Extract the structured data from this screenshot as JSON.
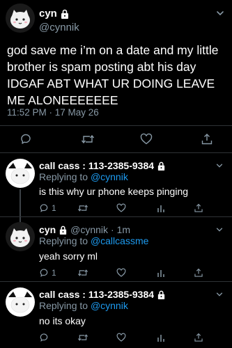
{
  "main_tweet": {
    "display_name": "cyn",
    "handle": "@cynnik",
    "text": "god save me i’m on a date and my little brother is spam posting abt his day IDGAF ABT WHAT UR DOING LEAVE ME ALONEEEEEEE",
    "timestamp": "11:52 PM · 17 May 26",
    "icons": [
      "lock-icon",
      "chevron-down-icon",
      "reply-icon",
      "retweet-icon",
      "like-icon",
      "share-icon"
    ]
  },
  "replies": [
    {
      "display_name": "call cass : 113-2385-9384",
      "handle": "",
      "time": "",
      "replying_prefix": "Replying to",
      "replying_to": "@cynnik",
      "text": "is this why ur phone keeps pinging",
      "reply_count": "1",
      "retweet_count": "",
      "like_count": ""
    },
    {
      "display_name": "cyn",
      "handle": "@cynnik",
      "time": "· 1m",
      "replying_prefix": "Replying to",
      "replying_to": "@callcassme",
      "text": "yeah sorry ml",
      "reply_count": "1",
      "retweet_count": "",
      "like_count": ""
    },
    {
      "display_name": "call cass : 113-2385-9384",
      "handle": "",
      "time": "",
      "replying_prefix": "Replying to",
      "replying_to": "@cynnik",
      "text": "no its okay",
      "reply_count": "",
      "retweet_count": "",
      "like_count": ""
    }
  ],
  "colors": {
    "background": "#000000",
    "text": "#ffffff",
    "secondary": "#8899a6",
    "link": "#1d9bf0",
    "divider": "#2f3336"
  }
}
